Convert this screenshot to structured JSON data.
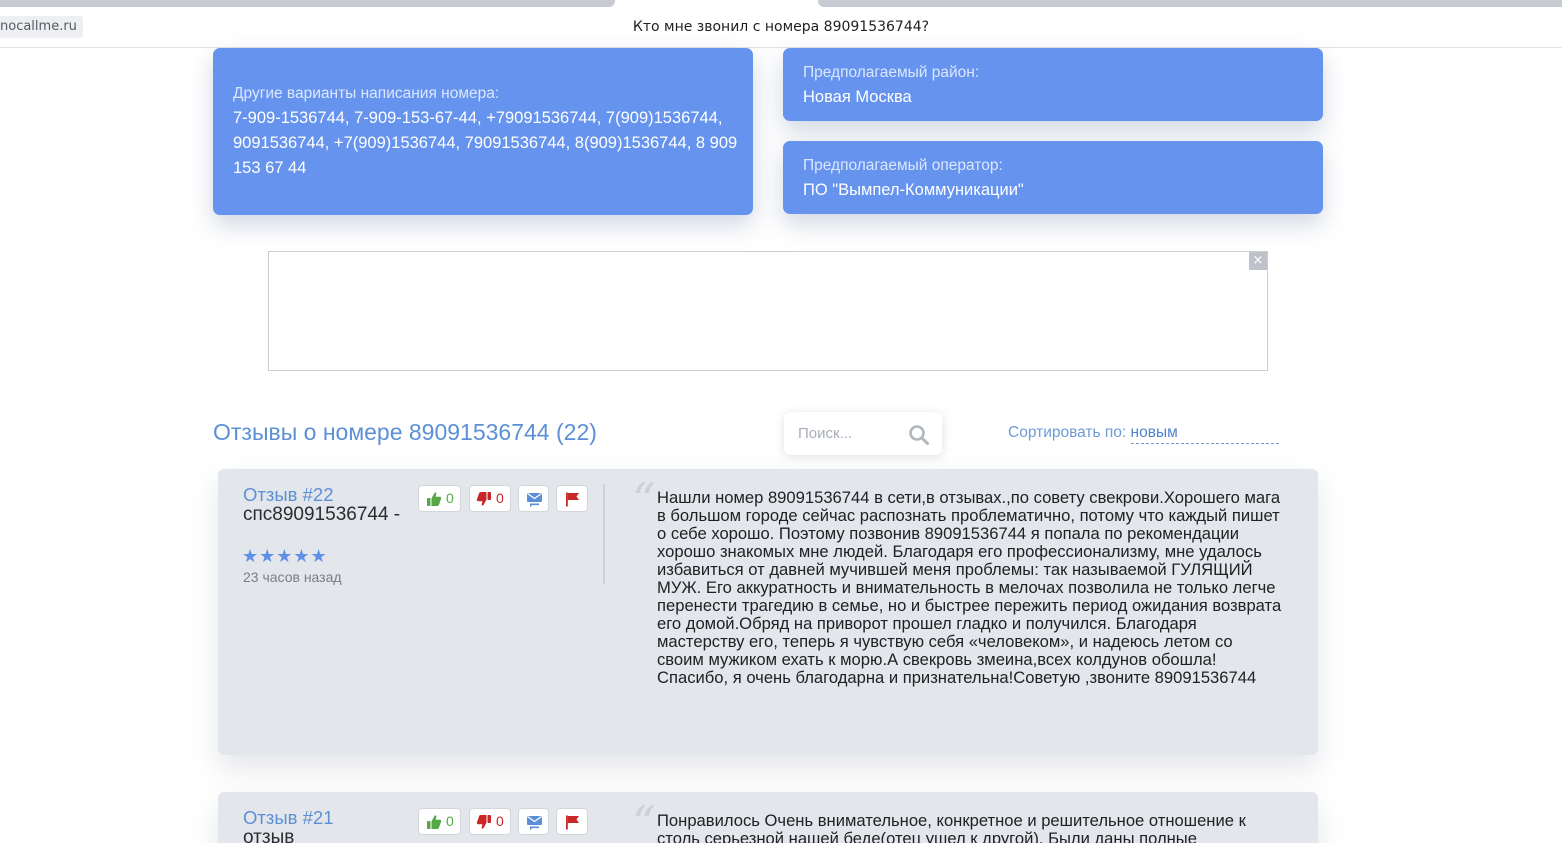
{
  "browser": {
    "domain": "nocallme.ru",
    "page_title": "Кто мне звонил с номера 89091536744?"
  },
  "info_cards": {
    "variants": {
      "label": "Другие варианты написания номера:",
      "value": "7-909-1536744, 7-909-153-67-44, +79091536744, 7(909)1536744, 9091536744, +7(909)1536744, 79091536744, 8(909)1536744, 8 909 153 67 44"
    },
    "region": {
      "label": "Предполагаемый район:",
      "value": "Новая Москва"
    },
    "operator": {
      "label": "Предполагаемый оператор:",
      "value": "ПО \"Вымпел-Коммуникации\""
    }
  },
  "ad": {
    "close_glyph": "×"
  },
  "reviews_section": {
    "title": "Отзывы о номере 89091536744 (22)",
    "search_placeholder": "Поиск...",
    "sort_label": "Сортировать по:",
    "sort_value": "новым"
  },
  "reviews": [
    {
      "number": "Отзыв #22",
      "author": "спс89091536744 -",
      "stars": "★★★★★",
      "rating": 5,
      "time": "23 часов назад",
      "likes": "0",
      "dislikes": "0",
      "quote_glyph": "“",
      "text": "Нашли номер 89091536744 в сети,в отзывах.,по совету свекрови.Хорошего мага в большом городе сейчас распознать проблематично, потому что каждый пишет о себе хорошо. Поэтому позвонив 89091536744 я попала по рекомендации хорошо знакомых мне людей. Благодаря его профессионализму, мне удалось избавиться от давней мучившей меня проблемы: так называемой ГУЛЯЩИЙ МУЖ. Его аккуратность и внимательность в мелочах позволила не только легче перенести трагедию в семье, но и быстрее пережить период ожидания возврата его домой.Обряд на приворот прошел гладко и получился. Благодаря мастерству его, теперь я чувствую себя «человеком», и надеюсь летом со своим мужиком ехать к морю.А свекровь змеина,всех колдунов обошла! Спасибо, я очень благодарна и признательна!Советую ,звоните 89091536744"
    },
    {
      "number": "Отзыв #21",
      "author": "отзыв",
      "likes": "0",
      "dislikes": "0",
      "quote_glyph": "“",
      "text": "Понравилось Очень внимательное, конкретное и решительное отношение к столь серьезной нашей беде(отец ушел к другой). Были даны полные"
    }
  ],
  "colors": {
    "card_blue": "#6593ee",
    "link_blue": "#5c90d6",
    "star_blue": "#5f8fe6",
    "like_green": "#57a844",
    "dislike_red": "#c82828",
    "review_bg": "#e3e6ea"
  },
  "icons": {
    "like": "thumbs-up-icon",
    "dislike": "thumbs-down-icon",
    "reply": "mail-reply-icon",
    "report": "flag-icon",
    "search": "search-icon",
    "close": "close-icon",
    "quote": "quote-icon"
  }
}
